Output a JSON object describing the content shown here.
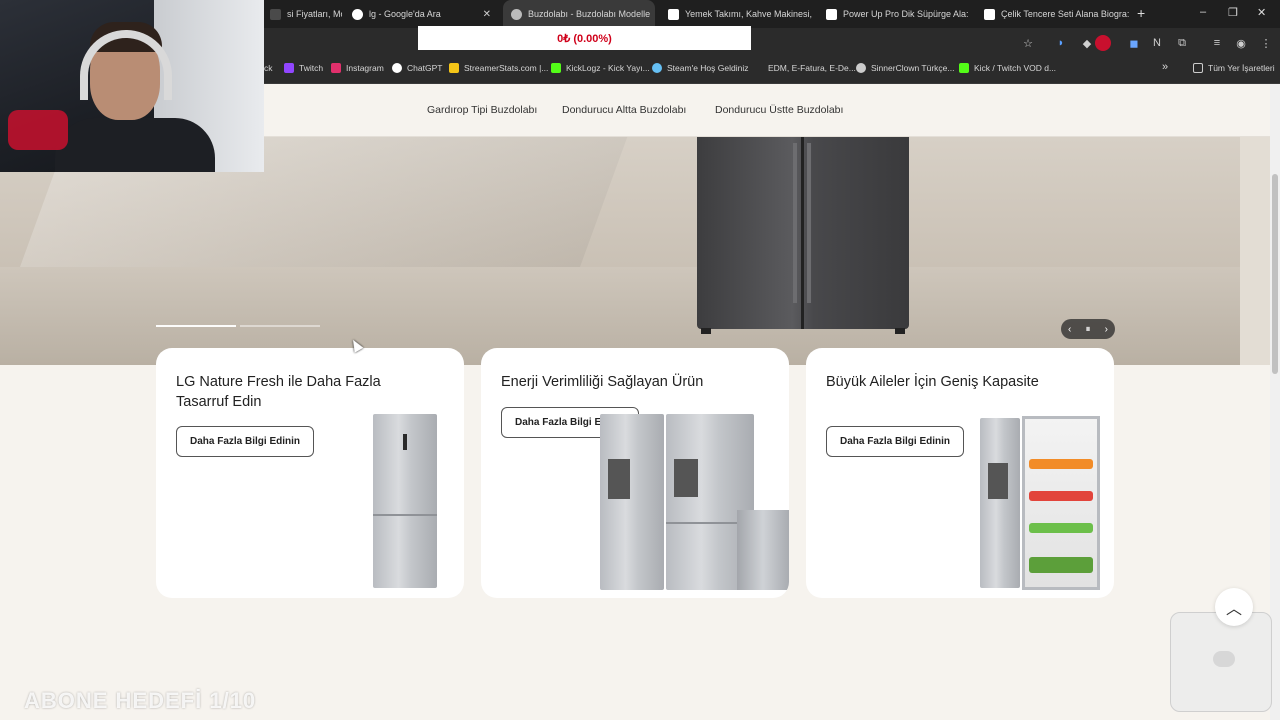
{
  "browser": {
    "tabs": [
      {
        "label": "si Fiyatları, Mo:",
        "fav": "#4a4a4a",
        "active": false
      },
      {
        "label": "lg - Google'da Ara",
        "fav": "#ffffff",
        "active": false
      },
      {
        "label": "Buzdolabı - Buzdolabı Modelle",
        "fav": "#bbbbbb",
        "active": true
      },
      {
        "label": "Yemek Takımı, Kahve Makinesi,",
        "fav": "#ffffff",
        "active": false
      },
      {
        "label": "Power Up Pro Dik Süpürge Ala:",
        "fav": "#ffffff",
        "active": false
      },
      {
        "label": "Çelik Tencere Seti Alana Biogra:",
        "fav": "#ffffff",
        "active": false
      }
    ],
    "new_tab": "+",
    "window_controls": [
      "–",
      "❐",
      "✕"
    ],
    "progress_text": "0₺ (0.00%)",
    "bookmarks": [
      {
        "label": "ck",
        "fav": "#333333"
      },
      {
        "label": "Twitch",
        "fav": "#9146ff"
      },
      {
        "label": "Instagram",
        "fav": "#e1306c"
      },
      {
        "label": "ChatGPT",
        "fav": "#ffffff"
      },
      {
        "label": "StreamerStats.com |...",
        "fav": "#f5c518"
      },
      {
        "label": "KickLogz - Kick Yayı...",
        "fav": "#53fc18"
      },
      {
        "label": "Steam'e Hoş Geldiniz",
        "fav": "#66c0f4"
      },
      {
        "label": "EDM, E-Fatura, E-De...",
        "fav": "#2b2b2b"
      },
      {
        "label": "SinnerClown Türkçe...",
        "fav": "#cccccc"
      },
      {
        "label": "Kick / Twitch VOD d...",
        "fav": "#53fc18"
      },
      {
        "label": "»",
        "fav": "#2b2b2b"
      },
      {
        "label": "Tüm Yer İşaretleri",
        "fav": "#2b2b2b"
      }
    ]
  },
  "subnav": {
    "items": [
      "Gardırop Tipi Buzdolabı",
      "Dondurucu Altta Buzdolabı",
      "Dondurucu Üstte Buzdolabı"
    ]
  },
  "hero": {
    "slides_indicator": [
      1,
      0
    ],
    "controls": {
      "prev": "‹",
      "pause": "⏸",
      "next": "›"
    }
  },
  "cards": [
    {
      "title": "LG Nature Fresh ile Daha Fazla Tasarruf Edin",
      "button": "Daha Fazla Bilgi Edinin"
    },
    {
      "title": "Enerji Verimliliği Sağlayan Ürün",
      "button": "Daha Fazla Bilgi Edinin"
    },
    {
      "title": "Büyük Aileler İçin Geniş Kapasite",
      "button": "Daha Fazla Bilgi Edinin"
    }
  ],
  "overlay": {
    "watermark": "ABONE HEDEFİ 1/10",
    "scroll_top": "︿"
  },
  "colors": {
    "page_bg": "#f6f3ee",
    "accent_red": "#d0001a",
    "tab_bar": "#1f1f1f"
  }
}
